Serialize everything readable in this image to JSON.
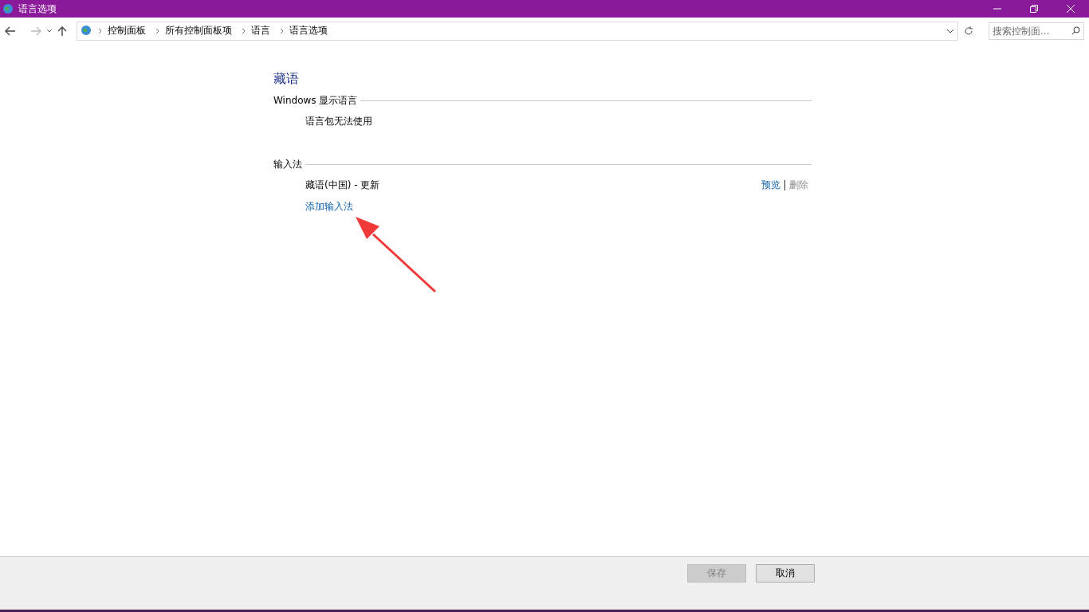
{
  "window": {
    "title": "语言选项"
  },
  "breadcrumb": [
    "控制面板",
    "所有控制面板项",
    "语言",
    "语言选项"
  ],
  "search": {
    "placeholder": "搜索控制面..."
  },
  "language": {
    "name": "藏语"
  },
  "sections": [
    {
      "heading": "Windows 显示语言",
      "items": [
        {
          "kind": "text",
          "label": "语言包无法使用"
        }
      ]
    },
    {
      "heading": "输入法",
      "items": [
        {
          "kind": "method",
          "label": "藏语(中国) - 更新",
          "actions": [
            {
              "label": "预览",
              "disabled": false
            },
            {
              "label": "删除",
              "disabled": true
            }
          ]
        },
        {
          "kind": "link",
          "label": "添加输入法"
        }
      ]
    }
  ],
  "buttons": [
    {
      "label": "保存",
      "disabled": true
    },
    {
      "label": "取消",
      "disabled": false
    }
  ]
}
